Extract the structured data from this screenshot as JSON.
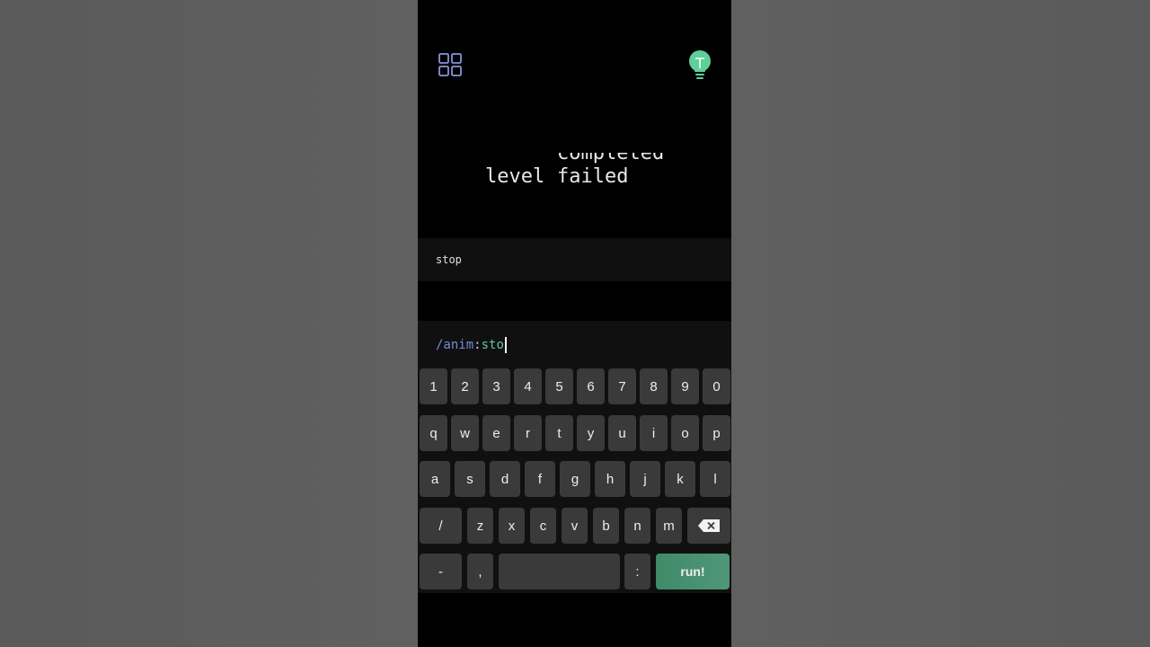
{
  "header": {
    "menu_icon": "grid-icon",
    "hint_icon": "lightbulb-icon"
  },
  "title": {
    "word": "level",
    "ticker_words": [
      "completed",
      "failed"
    ]
  },
  "output": {
    "text": "stop"
  },
  "command": {
    "prefix": "/anim",
    "separator": ":",
    "typed": "sto"
  },
  "keyboard": {
    "rows": [
      [
        "1",
        "2",
        "3",
        "4",
        "5",
        "6",
        "7",
        "8",
        "9",
        "0"
      ],
      [
        "q",
        "w",
        "e",
        "r",
        "t",
        "y",
        "u",
        "i",
        "o",
        "p"
      ],
      [
        "a",
        "s",
        "d",
        "f",
        "g",
        "h",
        "j",
        "k",
        "l"
      ],
      [
        "/",
        "z",
        "x",
        "c",
        "v",
        "b",
        "n",
        "m"
      ],
      [
        "-",
        ",",
        "",
        ":"
      ]
    ],
    "backspace_icon": "backspace-icon",
    "run_label": "run!"
  },
  "colors": {
    "accent": "#4f9778",
    "command_prefix": "#6f8fd8",
    "command_text": "#66c59b"
  }
}
